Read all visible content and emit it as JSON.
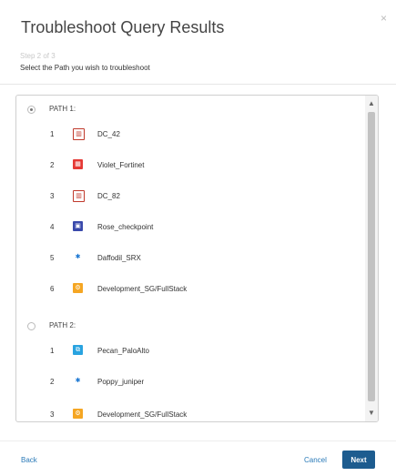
{
  "dialog": {
    "title": "Troubleshoot Query Results",
    "close_glyph": "×",
    "step": "Step 2 of 3",
    "instruction": "Select the Path you wish to troubleshoot"
  },
  "paths": [
    {
      "label": "PATH 1:",
      "selected": true,
      "hops": [
        {
          "n": "1",
          "name": "DC_42",
          "icon": "datacenter-icon"
        },
        {
          "n": "2",
          "name": "Violet_Fortinet",
          "icon": "fortinet-firewall-icon"
        },
        {
          "n": "3",
          "name": "DC_82",
          "icon": "datacenter-icon"
        },
        {
          "n": "4",
          "name": "Rose_checkpoint",
          "icon": "checkpoint-firewall-icon"
        },
        {
          "n": "5",
          "name": "Daffodil_SRX",
          "icon": "juniper-srx-icon"
        },
        {
          "n": "6",
          "name": "Development_SG/FullStack",
          "icon": "security-group-icon"
        }
      ]
    },
    {
      "label": "PATH 2:",
      "selected": false,
      "hops": [
        {
          "n": "1",
          "name": "Pecan_PaloAlto",
          "icon": "paloalto-firewall-icon"
        },
        {
          "n": "2",
          "name": "Poppy_juniper",
          "icon": "juniper-router-icon"
        },
        {
          "n": "3",
          "name": "Development_SG/FullStack",
          "icon": "security-group-icon"
        }
      ]
    }
  ],
  "scrollbar": {
    "up": "▲",
    "down": "▼"
  },
  "footer": {
    "back": "Back",
    "cancel": "Cancel",
    "next": "Next"
  },
  "colors": {
    "primary": "#1d5c8f",
    "link": "#2a7ab8"
  }
}
